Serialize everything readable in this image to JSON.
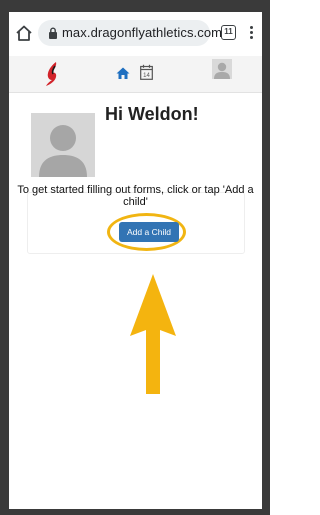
{
  "browser": {
    "url": "max.dragonflyathletics.com",
    "tab_count": "11"
  },
  "nav": {
    "calendar_day": "14"
  },
  "main": {
    "greeting": "Hi Weldon!",
    "instructions": "To get started filling out forms, click or tap 'Add a child'",
    "add_child_label": "Add a Child"
  },
  "colors": {
    "accent_button": "#3274b4",
    "highlight": "#f1b512",
    "brand_red": "#d2232a"
  }
}
